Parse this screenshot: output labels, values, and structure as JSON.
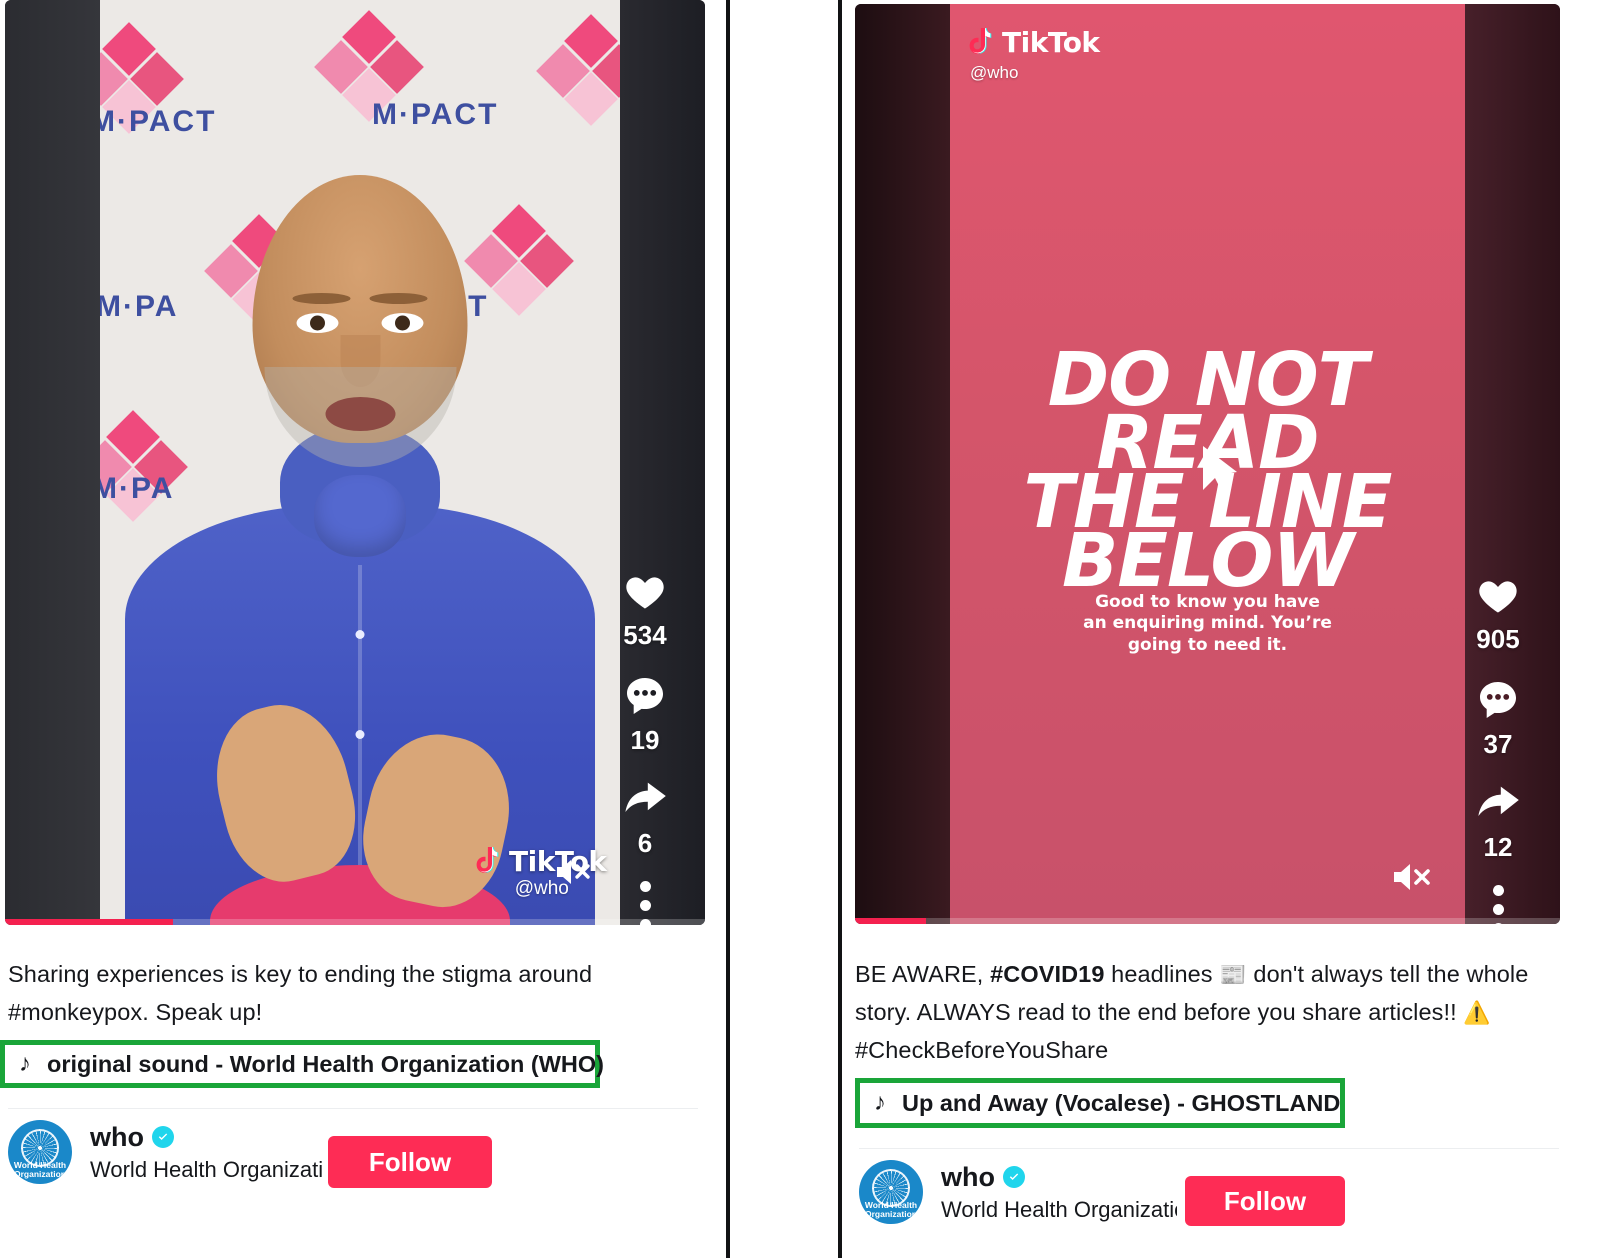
{
  "colors": {
    "brand_red": "#fe2c55",
    "highlight_green": "#1aa539",
    "verified_blue": "#20d5ec",
    "progress_red": "#f4214f",
    "poster_pink": "#d4556a",
    "who_blue": "#1a88c9"
  },
  "posts": [
    {
      "id": "post-left",
      "video": {
        "watermark_logo": "TikTok",
        "watermark_handle": "@who",
        "mute_icon": "mute-icon",
        "progress_percent": 24,
        "backdrop_text": "M·PACT"
      },
      "rail": [
        {
          "icon": "heart-icon",
          "name": "like-button",
          "count": "534"
        },
        {
          "icon": "comment-icon",
          "name": "comment-button",
          "count": "19"
        },
        {
          "icon": "share-icon",
          "name": "share-button",
          "count": "6"
        },
        {
          "icon": "ellipsis-icon",
          "name": "more-options-button",
          "count": ""
        }
      ],
      "caption": {
        "line1": "Sharing experiences is key to ending the stigma around",
        "line2_hashtag": "#monkeypox",
        "line2_rest": ". Speak up!"
      },
      "music": {
        "icon": "music-note-icon",
        "label": "original sound - World Health Organization (WHO)"
      },
      "author": {
        "avatar_line1": "World Health",
        "avatar_line2": "Organization",
        "handle": "who",
        "verified": true,
        "display_name": "World Health Organizatio",
        "follow_label": "Follow"
      }
    },
    {
      "id": "post-right",
      "video": {
        "header_logo": "TikTok",
        "header_handle": "@who",
        "poster_line1": "DO NOT READ",
        "poster_line2": "THE LINE",
        "poster_line3": "BELOW",
        "poster_small_line1": "Good to know you have",
        "poster_small_line2": "an enquiring mind. You’re",
        "poster_small_line3": "going to need it.",
        "mute_icon": "mute-icon",
        "progress_percent": 10
      },
      "rail": [
        {
          "icon": "heart-icon",
          "name": "like-button",
          "count": "905"
        },
        {
          "icon": "comment-icon",
          "name": "comment-button",
          "count": "37"
        },
        {
          "icon": "share-icon",
          "name": "share-button",
          "count": "12"
        },
        {
          "icon": "ellipsis-icon",
          "name": "more-options-button",
          "count": ""
        }
      ],
      "caption": {
        "seg1": "BE AWARE, ",
        "seg2_hashtag": "#COVID19",
        "seg3": " headlines ",
        "emoji_news": "📰",
        "seg4": " don't always tell the whole story. ALWAYS read to the end before you share articles!! ",
        "emoji_warn": "⚠️",
        "seg5_hashtag": "#CheckBeforeYouShare"
      },
      "music": {
        "icon": "music-note-icon",
        "label": "Up and Away (Vocalese) - GHOSTLAND"
      },
      "author": {
        "avatar_line1": "World Health",
        "avatar_line2": "Organization",
        "handle": "who",
        "verified": true,
        "display_name": "World Health Organizatio",
        "follow_label": "Follow"
      }
    }
  ]
}
